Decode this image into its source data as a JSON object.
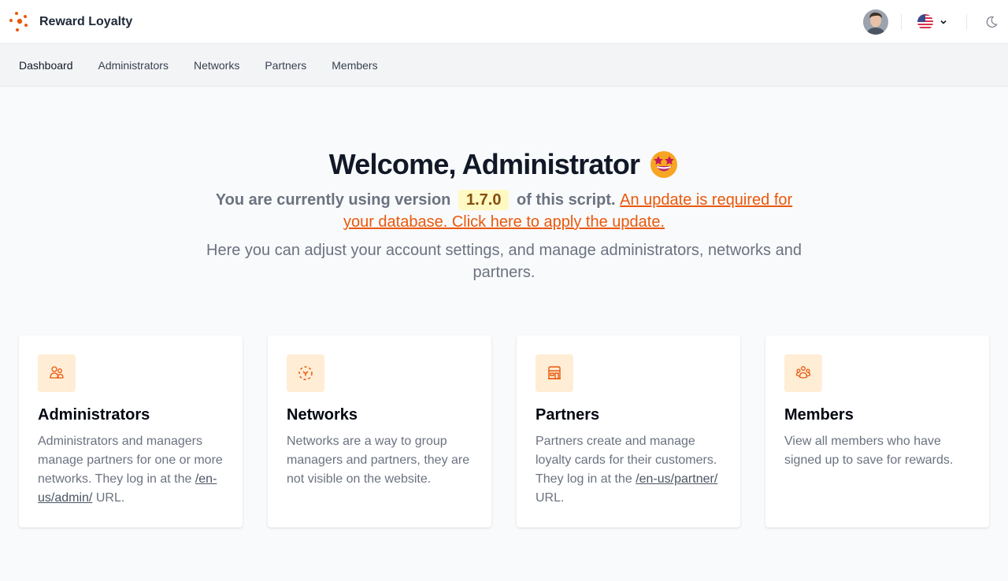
{
  "app": {
    "name": "Reward Loyalty",
    "brand_color": "#ea580c"
  },
  "header": {
    "avatar_alt": "User avatar",
    "language": {
      "icon": "us-flag-icon",
      "selected": "en-us"
    },
    "theme_toggle_icon": "moon-icon"
  },
  "nav": {
    "items": [
      {
        "label": "Dashboard",
        "active": true
      },
      {
        "label": "Administrators",
        "active": false
      },
      {
        "label": "Networks",
        "active": false
      },
      {
        "label": "Partners",
        "active": false
      },
      {
        "label": "Members",
        "active": false
      }
    ]
  },
  "hero": {
    "title": "Welcome, Administrator",
    "title_emoji": "star-struck-emoji",
    "version_prefix": "You are currently using version",
    "version": "1.7.0",
    "version_suffix": "of this script.",
    "update_link": "An update is required for your database. Click here to apply the update.",
    "description": "Here you can adjust your account settings, and manage administrators, networks and partners."
  },
  "cards": [
    {
      "icon": "users-icon",
      "title": "Administrators",
      "text_before": "Administrators and managers manage partners for one or more networks. They log in at the",
      "link": "/en-us/admin/",
      "text_after": "URL."
    },
    {
      "icon": "network-icon",
      "title": "Networks",
      "text": "Networks are a way to group managers and partners, they are not visible on the website."
    },
    {
      "icon": "store-icon",
      "title": "Partners",
      "text_before": "Partners create and manage loyalty cards for their customers. They log in at the",
      "link": "/en-us/partner/",
      "text_after": "URL."
    },
    {
      "icon": "members-icon",
      "title": "Members",
      "text": "View all members who have signed up to save for rewards."
    }
  ]
}
